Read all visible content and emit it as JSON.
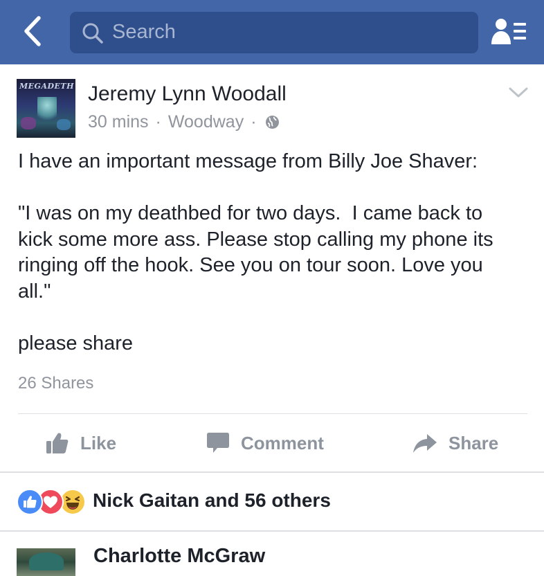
{
  "header": {
    "search_placeholder": "Search",
    "bar_color": "#4366a8",
    "search_bg": "#2f4f8c"
  },
  "post": {
    "author": "Jeremy Lynn Woodall",
    "time": "30 mins",
    "location": "Woodway",
    "separator": "·",
    "avatar_logo_text": "MEGADETH",
    "text_lines": [
      "I have an important message from Billy Joe Shaver:",
      "",
      "\"I was on my deathbed for two days.  I came back to",
      "kick some more ass. Please stop calling my phone its",
      "ringing off the hook. See you on tour soon. Love you",
      "all.\"",
      "",
      "please share"
    ],
    "shares": "26 Shares"
  },
  "actions": {
    "like": "Like",
    "comment": "Comment",
    "share": "Share"
  },
  "reactions": {
    "summary": "Nick Gaitan and 56 others",
    "types": [
      "like",
      "love",
      "haha"
    ]
  },
  "comments": [
    {
      "author": "Charlotte McGraw"
    }
  ]
}
